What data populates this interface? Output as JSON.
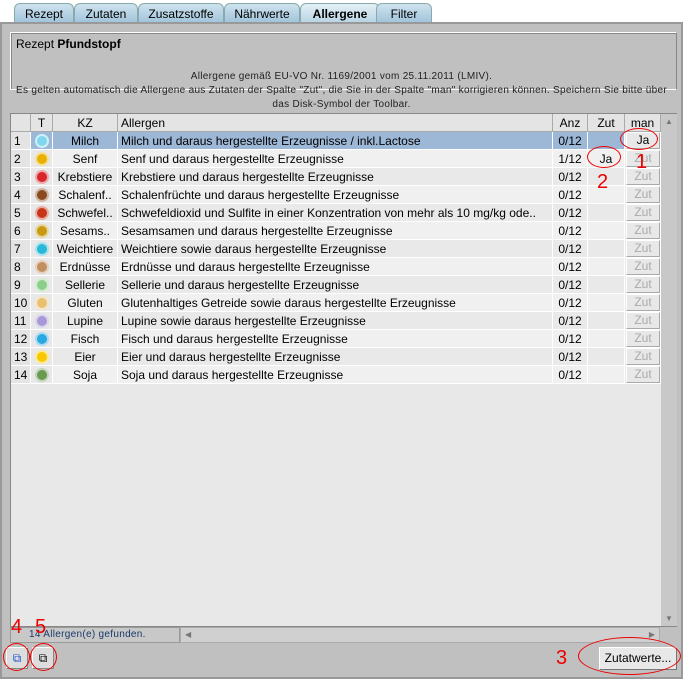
{
  "tabs": [
    "Rezept",
    "Zutaten",
    "Zusatzstoffe",
    "Nährwerte",
    "Allergene",
    "Filter"
  ],
  "active_tab": "Allergene",
  "recipe": {
    "label": "Rezept",
    "name": "Pfundstopf"
  },
  "info": [
    "Allergene gemäß EU-VO Nr. 1169/2001 vom 25.11.2011 (LMIV).",
    "Es gelten automatisch die Allergene aus Zutaten der Spalte \"Zut\", die Sie in der Spalte \"man\" korrigieren können. Speichern Sie bitte über",
    "das Disk-Symbol der Toolbar."
  ],
  "columns": [
    "",
    "T",
    "KZ",
    "Allergen",
    "Anz",
    "Zut",
    "man"
  ],
  "rows": [
    {
      "n": "1",
      "kz": "Milch",
      "text": "Milch und daraus hergestellte Erzeugnisse / inkl.Lactose",
      "anz": "0/12",
      "zut": "",
      "man": "Ja",
      "color": "#7fd6ee"
    },
    {
      "n": "2",
      "kz": "Senf",
      "text": "Senf und daraus hergestellte Erzeugnisse",
      "anz": "1/12",
      "zut": "Ja",
      "man": "Zut",
      "color": "#e8b000"
    },
    {
      "n": "3",
      "kz": "Krebstiere",
      "text": "Krebstiere und daraus hergestellte Erzeugnisse",
      "anz": "0/12",
      "zut": "",
      "man": "Zut",
      "color": "#d8262a"
    },
    {
      "n": "4",
      "kz": "Schalenf..",
      "text": "Schalenfrüchte und daraus hergestellte Erzeugnisse",
      "anz": "0/12",
      "zut": "",
      "man": "Zut",
      "color": "#8a4a1e"
    },
    {
      "n": "5",
      "kz": "Schwefel..",
      "text": "Schwefeldioxid und Sulfite in einer Konzentration von mehr als 10 mg/kg ode..",
      "anz": "0/12",
      "zut": "",
      "man": "Zut",
      "color": "#c8341a"
    },
    {
      "n": "6",
      "kz": "Sesams..",
      "text": "Sesamsamen und daraus hergestellte Erzeugnisse",
      "anz": "0/12",
      "zut": "",
      "man": "Zut",
      "color": "#c99a10"
    },
    {
      "n": "7",
      "kz": "Weichtiere",
      "text": "Weichtiere sowie daraus hergestellte Erzeugnisse",
      "anz": "0/12",
      "zut": "",
      "man": "Zut",
      "color": "#28b8d8"
    },
    {
      "n": "8",
      "kz": "Erdnüsse",
      "text": "Erdnüsse und daraus hergestellte Erzeugnisse",
      "anz": "0/12",
      "zut": "",
      "man": "Zut",
      "color": "#c09060"
    },
    {
      "n": "9",
      "kz": "Sellerie",
      "text": "Sellerie und daraus hergestellte Erzeugnisse",
      "anz": "0/12",
      "zut": "",
      "man": "Zut",
      "color": "#8ccf8c"
    },
    {
      "n": "10",
      "kz": "Gluten",
      "text": "Glutenhaltiges Getreide sowie daraus hergestellte Erzeugnisse",
      "anz": "0/12",
      "zut": "",
      "man": "Zut",
      "color": "#e8c070"
    },
    {
      "n": "11",
      "kz": "Lupine",
      "text": "Lupine sowie daraus hergestellte Erzeugnisse",
      "anz": "0/12",
      "zut": "",
      "man": "Zut",
      "color": "#a898d8"
    },
    {
      "n": "12",
      "kz": "Fisch",
      "text": "Fisch und daraus hergestellte Erzeugnisse",
      "anz": "0/12",
      "zut": "",
      "man": "Zut",
      "color": "#2aa8e0"
    },
    {
      "n": "13",
      "kz": "Eier",
      "text": "Eier und daraus hergestellte Erzeugnisse",
      "anz": "0/12",
      "zut": "",
      "man": "Zut",
      "color": "#f8c800"
    },
    {
      "n": "14",
      "kz": "Soja",
      "text": "Soja und daraus hergestellte Erzeugnisse",
      "anz": "0/12",
      "zut": "",
      "man": "Zut",
      "color": "#6a9a50"
    }
  ],
  "status": "14 Allergen(e) gefunden.",
  "buttons": {
    "zutatwerte": "Zutatwerte..."
  },
  "annotations": [
    "1",
    "2",
    "3",
    "4",
    "5"
  ]
}
